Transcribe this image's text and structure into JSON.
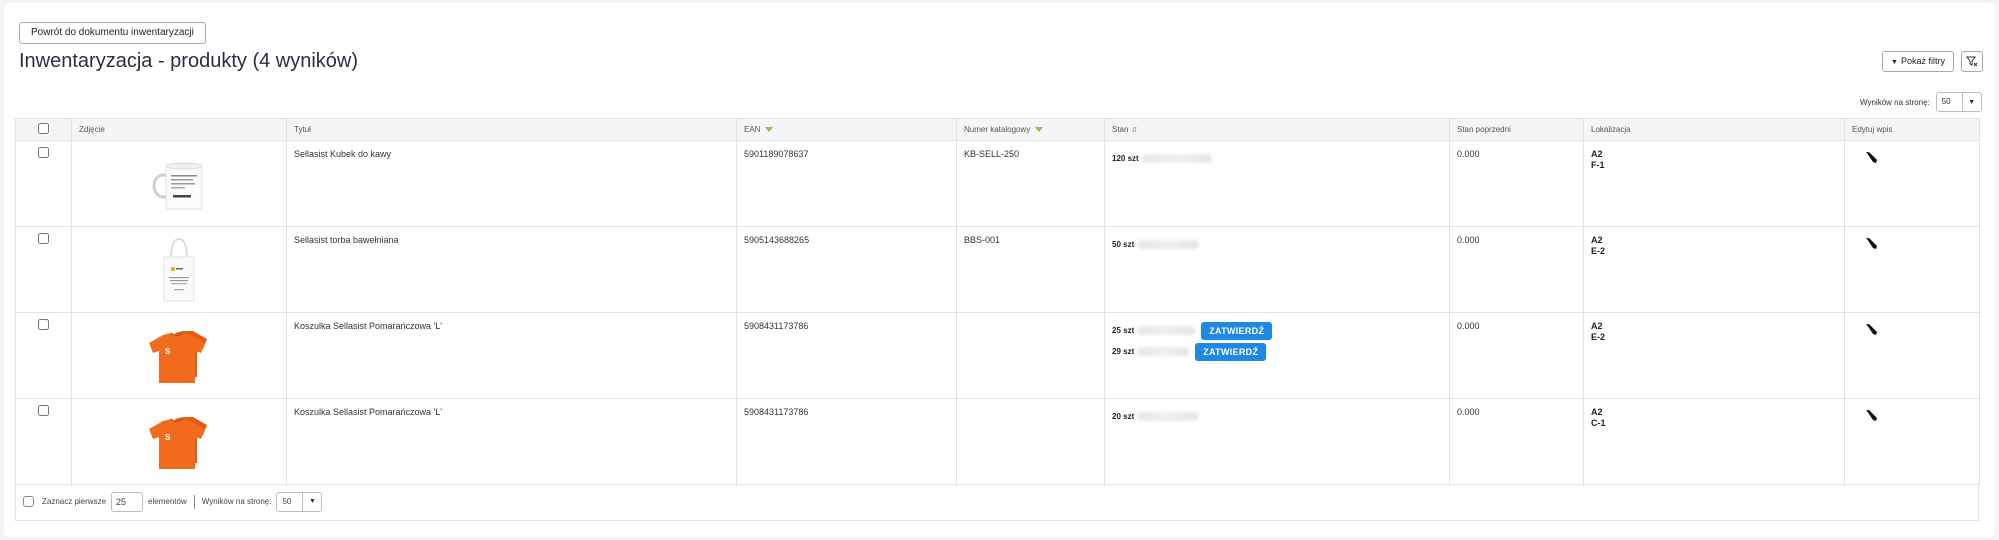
{
  "header": {
    "back_label": "Powrót do dokumentu inwentaryzacji",
    "title": "Inwentaryzacja - produkty (4 wyników)",
    "filters_label": "Pokaż filtry",
    "per_page_label": "Wyników na stronę:",
    "per_page_value": "50"
  },
  "columns": {
    "photo": "Zdjęcie",
    "title": "Tytuł",
    "ean": "EAN",
    "catalog": "Numer katalogowy",
    "stock": "Stan",
    "prev_stock": "Stan poprzedni",
    "location": "Lokalizacja",
    "edit": "Edytuj wpis"
  },
  "rows": [
    {
      "title": "Sellasist Kubek do kawy",
      "ean": "5901189078637",
      "catalog": "KB-SELL-250",
      "stock": [
        {
          "qty": "120 szt"
        }
      ],
      "prev": "0.000",
      "loc1": "A2",
      "loc2": "F-1",
      "image": "mug-image"
    },
    {
      "title": "Sellasist torba bawełniana",
      "ean": "5905143688265",
      "catalog": "BBS-001",
      "stock": [
        {
          "qty": "50 szt"
        }
      ],
      "prev": "0.000",
      "loc1": "A2",
      "loc2": "E-2",
      "image": "bag-image"
    },
    {
      "title": "Koszulka Sellasist Pomarańczowa 'L'",
      "ean": "5908431173786",
      "catalog": "",
      "stock": [
        {
          "qty": "25 szt",
          "confirm": "ZATWIERDŹ"
        },
        {
          "qty": "29 szt",
          "confirm": "ZATWIERDŹ"
        }
      ],
      "prev": "0.000",
      "loc1": "A2",
      "loc2": "E-2",
      "image": "tshirt-image"
    },
    {
      "title": "Koszulka Sellasist Pomarańczowa 'L'",
      "ean": "5908431173786",
      "catalog": "",
      "stock": [
        {
          "qty": "20 szt"
        }
      ],
      "prev": "0.000",
      "loc1": "A2",
      "loc2": "C-1",
      "image": "tshirt-image"
    }
  ],
  "footer": {
    "select_first_label": "Zaznacz pierwsze",
    "select_first_value": "25",
    "elements_label": "elementów",
    "per_page_label": "Wyników na stronę:",
    "per_page_value": "50"
  },
  "colors": {
    "confirm_button": "#1e88e5",
    "sort_indicator": "#8bc34a",
    "shirt_orange": "#f26b1d"
  }
}
